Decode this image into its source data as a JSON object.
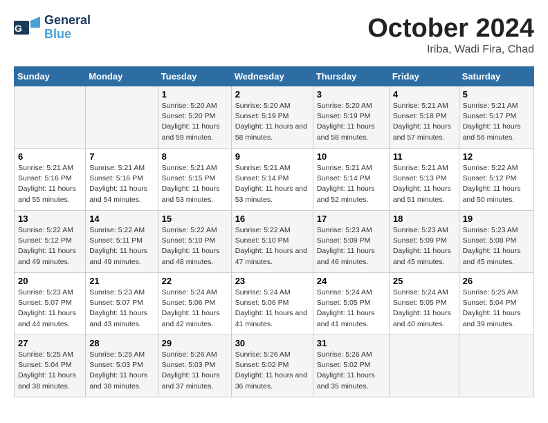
{
  "header": {
    "logo_general": "General",
    "logo_blue": "Blue",
    "month": "October 2024",
    "location": "Iriba, Wadi Fira, Chad"
  },
  "columns": [
    "Sunday",
    "Monday",
    "Tuesday",
    "Wednesday",
    "Thursday",
    "Friday",
    "Saturday"
  ],
  "rows": [
    [
      {
        "day": "",
        "info": ""
      },
      {
        "day": "",
        "info": ""
      },
      {
        "day": "1",
        "info": "Sunrise: 5:20 AM\nSunset: 5:20 PM\nDaylight: 11 hours and 59 minutes."
      },
      {
        "day": "2",
        "info": "Sunrise: 5:20 AM\nSunset: 5:19 PM\nDaylight: 11 hours and 58 minutes."
      },
      {
        "day": "3",
        "info": "Sunrise: 5:20 AM\nSunset: 5:19 PM\nDaylight: 11 hours and 58 minutes."
      },
      {
        "day": "4",
        "info": "Sunrise: 5:21 AM\nSunset: 5:18 PM\nDaylight: 11 hours and 57 minutes."
      },
      {
        "day": "5",
        "info": "Sunrise: 5:21 AM\nSunset: 5:17 PM\nDaylight: 11 hours and 56 minutes."
      }
    ],
    [
      {
        "day": "6",
        "info": "Sunrise: 5:21 AM\nSunset: 5:16 PM\nDaylight: 11 hours and 55 minutes."
      },
      {
        "day": "7",
        "info": "Sunrise: 5:21 AM\nSunset: 5:16 PM\nDaylight: 11 hours and 54 minutes."
      },
      {
        "day": "8",
        "info": "Sunrise: 5:21 AM\nSunset: 5:15 PM\nDaylight: 11 hours and 53 minutes."
      },
      {
        "day": "9",
        "info": "Sunrise: 5:21 AM\nSunset: 5:14 PM\nDaylight: 11 hours and 53 minutes."
      },
      {
        "day": "10",
        "info": "Sunrise: 5:21 AM\nSunset: 5:14 PM\nDaylight: 11 hours and 52 minutes."
      },
      {
        "day": "11",
        "info": "Sunrise: 5:21 AM\nSunset: 5:13 PM\nDaylight: 11 hours and 51 minutes."
      },
      {
        "day": "12",
        "info": "Sunrise: 5:22 AM\nSunset: 5:12 PM\nDaylight: 11 hours and 50 minutes."
      }
    ],
    [
      {
        "day": "13",
        "info": "Sunrise: 5:22 AM\nSunset: 5:12 PM\nDaylight: 11 hours and 49 minutes."
      },
      {
        "day": "14",
        "info": "Sunrise: 5:22 AM\nSunset: 5:11 PM\nDaylight: 11 hours and 49 minutes."
      },
      {
        "day": "15",
        "info": "Sunrise: 5:22 AM\nSunset: 5:10 PM\nDaylight: 11 hours and 48 minutes."
      },
      {
        "day": "16",
        "info": "Sunrise: 5:22 AM\nSunset: 5:10 PM\nDaylight: 11 hours and 47 minutes."
      },
      {
        "day": "17",
        "info": "Sunrise: 5:23 AM\nSunset: 5:09 PM\nDaylight: 11 hours and 46 minutes."
      },
      {
        "day": "18",
        "info": "Sunrise: 5:23 AM\nSunset: 5:09 PM\nDaylight: 11 hours and 45 minutes."
      },
      {
        "day": "19",
        "info": "Sunrise: 5:23 AM\nSunset: 5:08 PM\nDaylight: 11 hours and 45 minutes."
      }
    ],
    [
      {
        "day": "20",
        "info": "Sunrise: 5:23 AM\nSunset: 5:07 PM\nDaylight: 11 hours and 44 minutes."
      },
      {
        "day": "21",
        "info": "Sunrise: 5:23 AM\nSunset: 5:07 PM\nDaylight: 11 hours and 43 minutes."
      },
      {
        "day": "22",
        "info": "Sunrise: 5:24 AM\nSunset: 5:06 PM\nDaylight: 11 hours and 42 minutes."
      },
      {
        "day": "23",
        "info": "Sunrise: 5:24 AM\nSunset: 5:06 PM\nDaylight: 11 hours and 41 minutes."
      },
      {
        "day": "24",
        "info": "Sunrise: 5:24 AM\nSunset: 5:05 PM\nDaylight: 11 hours and 41 minutes."
      },
      {
        "day": "25",
        "info": "Sunrise: 5:24 AM\nSunset: 5:05 PM\nDaylight: 11 hours and 40 minutes."
      },
      {
        "day": "26",
        "info": "Sunrise: 5:25 AM\nSunset: 5:04 PM\nDaylight: 11 hours and 39 minutes."
      }
    ],
    [
      {
        "day": "27",
        "info": "Sunrise: 5:25 AM\nSunset: 5:04 PM\nDaylight: 11 hours and 38 minutes."
      },
      {
        "day": "28",
        "info": "Sunrise: 5:25 AM\nSunset: 5:03 PM\nDaylight: 11 hours and 38 minutes."
      },
      {
        "day": "29",
        "info": "Sunrise: 5:26 AM\nSunset: 5:03 PM\nDaylight: 11 hours and 37 minutes."
      },
      {
        "day": "30",
        "info": "Sunrise: 5:26 AM\nSunset: 5:02 PM\nDaylight: 11 hours and 36 minutes."
      },
      {
        "day": "31",
        "info": "Sunrise: 5:26 AM\nSunset: 5:02 PM\nDaylight: 11 hours and 35 minutes."
      },
      {
        "day": "",
        "info": ""
      },
      {
        "day": "",
        "info": ""
      }
    ]
  ]
}
